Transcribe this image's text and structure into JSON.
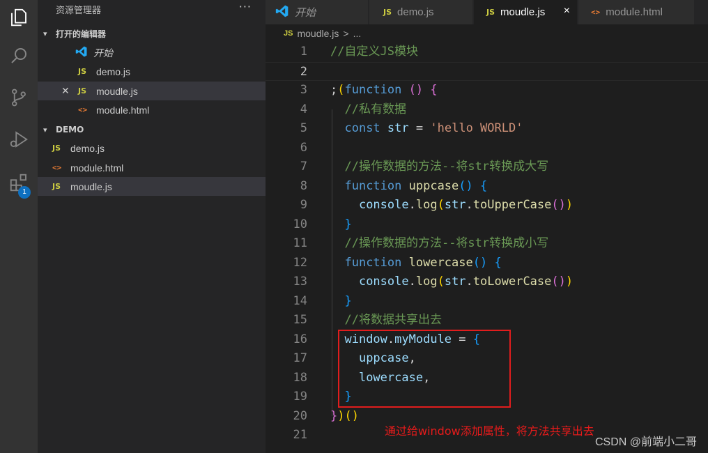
{
  "activity_bar": {
    "icons": [
      "files-icon",
      "search-icon",
      "source-control-icon",
      "run-debug-icon",
      "extensions-icon"
    ],
    "extensions_badge": "1"
  },
  "sidebar": {
    "title": "资源管理器",
    "more": "···",
    "open_editors": {
      "header": "打开的编辑器",
      "items": [
        {
          "icon": "vscode-icon",
          "label": "开始"
        },
        {
          "icon": "JS",
          "label": "demo.js"
        },
        {
          "icon": "JS",
          "label": "moudle.js"
        },
        {
          "icon": "<>",
          "label": "module.html"
        }
      ]
    },
    "folder": {
      "header": "DEMO",
      "items": [
        {
          "icon": "JS",
          "label": "demo.js"
        },
        {
          "icon": "<>",
          "label": "module.html"
        },
        {
          "icon": "JS",
          "label": "moudle.js"
        }
      ]
    }
  },
  "tabs": [
    {
      "icon": "vscode-icon",
      "label": "开始"
    },
    {
      "icon": "JS",
      "label": "demo.js"
    },
    {
      "icon": "JS",
      "label": "moudle.js",
      "close": "×"
    },
    {
      "icon": "<>",
      "label": "module.html"
    }
  ],
  "breadcrumb": {
    "icon": "JS",
    "file": "moudle.js",
    "sep": ">",
    "rest": "..."
  },
  "editor": {
    "line_numbers": [
      "1",
      "2",
      "3",
      "4",
      "5",
      "6",
      "7",
      "8",
      "9",
      "10",
      "11",
      "12",
      "13",
      "14",
      "15",
      "16",
      "17",
      "18",
      "19",
      "20",
      "21"
    ],
    "lines": [
      "//自定义JS模块",
      "",
      ";(function () {",
      "  //私有数据",
      "  const str = 'hello WORLD'",
      "",
      "  //操作数据的方法--将str转换成大写",
      "  function uppcase() {",
      "    console.log(str.toUpperCase())",
      "  }",
      "  //操作数据的方法--将str转换成小写",
      "  function lowercase() {",
      "    console.log(str.toLowerCase())",
      "  }",
      "  //将数据共享出去",
      "  window.myModule = {",
      "    uppcase,",
      "    lowercase,",
      "  }",
      "})()",
      ""
    ]
  },
  "annotation": "通过给window添加属性，将方法共享出去",
  "watermark": "CSDN @前端小二哥",
  "colors": {
    "highlight_box": "#e11d1d",
    "annotation": "#e81b1b",
    "comment": "#6a9955",
    "keyword": "#569cd6",
    "function": "#dcdcaa",
    "string": "#ce9178"
  }
}
